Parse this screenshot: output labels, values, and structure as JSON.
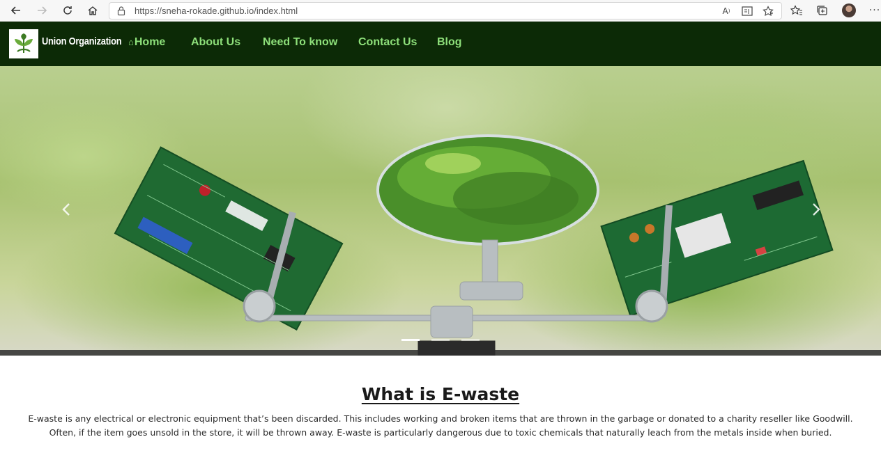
{
  "browser": {
    "url": "https://sneha-rokade.github.io/index.html",
    "icons": [
      "back-icon",
      "forward-icon",
      "refresh-icon",
      "home-icon",
      "lock-icon",
      "read-aloud-icon",
      "reader-view-icon",
      "favorite-add-icon",
      "favorites-icon",
      "collections-icon",
      "profile-avatar",
      "more-icon"
    ]
  },
  "navbar": {
    "brand": "Union Organization",
    "links": [
      {
        "label": "Home",
        "icon": "home-icon"
      },
      {
        "label": "About Us"
      },
      {
        "label": "Need To know"
      },
      {
        "label": "Contact Us"
      },
      {
        "label": "Blog"
      }
    ],
    "colors": {
      "background": "#0c2a06",
      "link": "#8ee07a",
      "brand": "#ffffff"
    }
  },
  "hero": {
    "controls": {
      "prev": "chevron-left-icon",
      "next": "chevron-right-icon",
      "slides": 3,
      "active_slide": 1
    }
  },
  "content": {
    "title": "What is E-waste",
    "text": "E-waste is any electrical or electronic equipment that’s been discarded. This includes working and broken items that are thrown in the garbage or donated to a charity reseller like Goodwill. Often, if the item goes unsold in the store, it will be thrown away. E-waste is particularly dangerous due to toxic chemicals that naturally leach from the metals inside when buried."
  }
}
